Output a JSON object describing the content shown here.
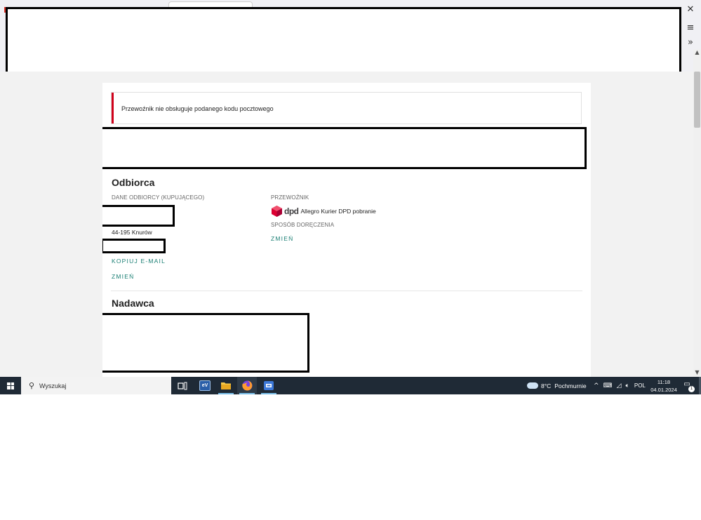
{
  "browser": {
    "close_icon": "close-icon",
    "menu_icon": "hamburger-menu-icon",
    "more_icon": "chevron-double-right-icon"
  },
  "alert": {
    "message": "Przewoźnik nie obsługuje podanego kodu pocztowego",
    "accent_color": "#d0021b"
  },
  "recipient": {
    "section_title": "Odbiorca",
    "details_label": "DANE ODBIORCY (KUPUJĄCEGO)",
    "postal_city": "44-195 Knurów",
    "copy_email_label": "KOPIUJ E-MAIL",
    "change_label": "ZMIEŃ"
  },
  "carrier": {
    "label": "PRZEWOŹNIK",
    "logo_text": "dpd",
    "name": "Allegro Kurier DPD pobranie",
    "delivery_method_label": "SPOSÓB DORĘCZENIA",
    "change_label": "ZMIEŃ"
  },
  "sender": {
    "section_title": "Nadawca"
  },
  "taskbar": {
    "search_placeholder": "Wyszukaj",
    "weather_temp": "8°C",
    "weather_desc": "Pochmurnie",
    "language": "POL",
    "time": "11:18",
    "date": "04.01.2024",
    "notification_count": "1"
  },
  "colors": {
    "link": "#1a7f74",
    "taskbar": "#1f2a36",
    "page_background": "#f2f2f2"
  }
}
